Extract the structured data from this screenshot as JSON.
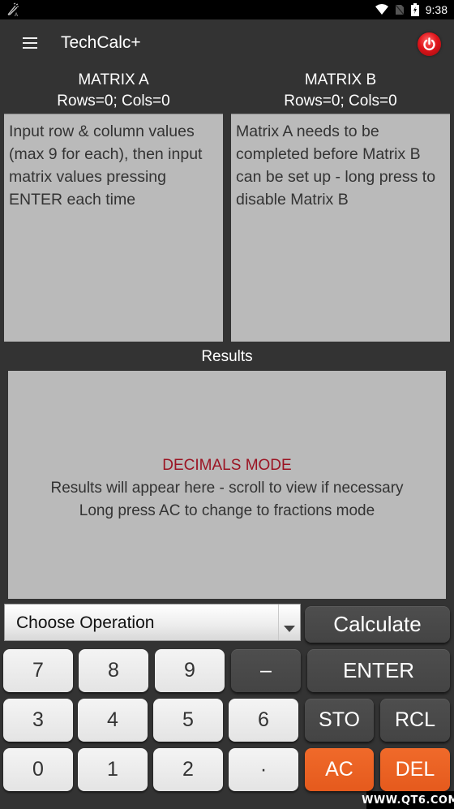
{
  "status_bar": {
    "time": "9:38",
    "icons": [
      "debug-icon",
      "wifi-icon",
      "no-sim-icon",
      "battery-charging-icon"
    ]
  },
  "app_bar": {
    "title": "TechCalc+",
    "menu_icon": "menu-icon",
    "power_icon": "power-icon"
  },
  "matrix_a": {
    "title": "MATRIX A",
    "dims": "Rows=0; Cols=0",
    "content": "Input row & column values (max 9 for each), then input matrix values pressing ENTER each time"
  },
  "matrix_b": {
    "title": "MATRIX B",
    "dims": "Rows=0; Cols=0",
    "content": "Matrix A needs to be completed before Matrix B can be set up - long press to disable Matrix B"
  },
  "results": {
    "title": "Results",
    "mode": "DECIMALS MODE",
    "line1": "Results will appear here - scroll to view if necessary",
    "line2": "Long press AC to change to fractions mode"
  },
  "operation_select": {
    "selected": "Choose Operation"
  },
  "buttons": {
    "calculate": "Calculate",
    "enter": "ENTER",
    "sto": "STO",
    "rcl": "RCL",
    "ac": "AC",
    "del": "DEL",
    "minus": "–",
    "decimal": "·"
  },
  "keypad_digits": [
    "7",
    "8",
    "9",
    "3",
    "4",
    "5",
    "6",
    "0",
    "1",
    "2"
  ],
  "colors": {
    "background": "#333333",
    "panel": "#bababa",
    "mode_text": "#9b1423",
    "accent_orange": "#e55a1d",
    "key_light": "#e8e8e8",
    "key_dark": "#474747"
  },
  "watermark": "WWW.QT6.COM"
}
